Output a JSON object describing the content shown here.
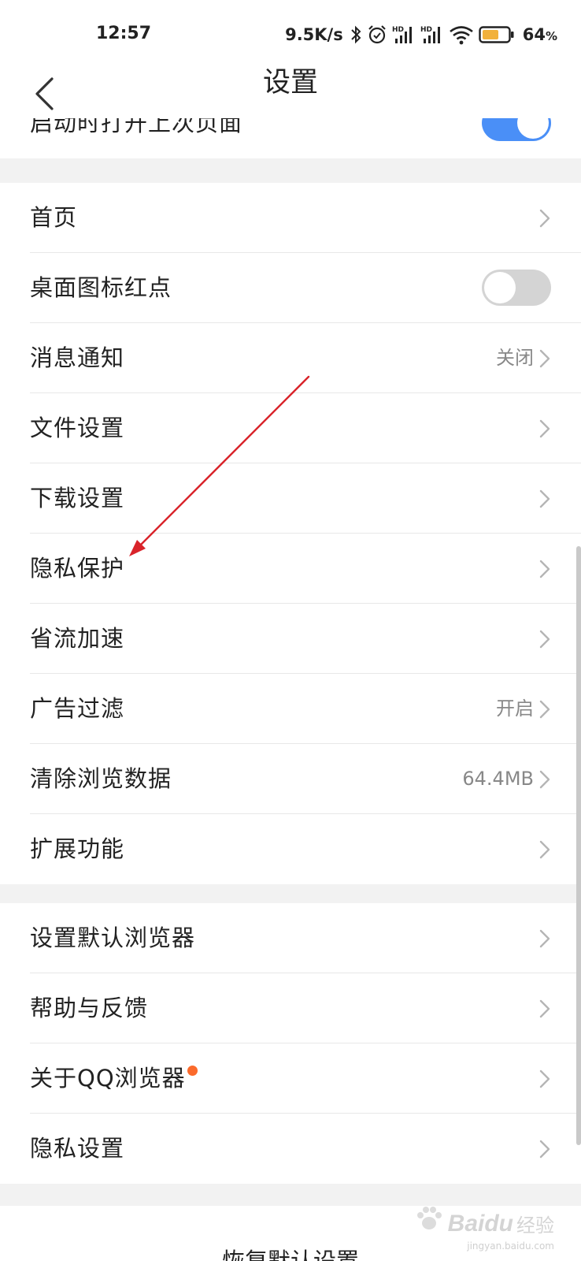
{
  "status_bar": {
    "time": "12:57",
    "net_speed": "9.5K/s",
    "battery_percent": "64",
    "battery_unit": "%",
    "battery_level": 0.64,
    "battery_color": "#f2b13a",
    "icons": [
      "bluetooth-icon",
      "alarm-icon",
      "hd-signal-icon",
      "hd-signal-icon",
      "wifi-icon",
      "battery-icon"
    ]
  },
  "header": {
    "title": "设置",
    "back_icon": "back-arrow-icon"
  },
  "top_partial_row": {
    "label": "启动时打开上次页面",
    "toggle_on": true
  },
  "group1": [
    {
      "label": "首页",
      "value": "",
      "control": "chevron"
    },
    {
      "label": "桌面图标红点",
      "value": "",
      "control": "toggle-off"
    },
    {
      "label": "消息通知",
      "value": "关闭",
      "control": "chevron"
    },
    {
      "label": "文件设置",
      "value": "",
      "control": "chevron"
    },
    {
      "label": "下载设置",
      "value": "",
      "control": "chevron"
    },
    {
      "label": "隐私保护",
      "value": "",
      "control": "chevron"
    },
    {
      "label": "省流加速",
      "value": "",
      "control": "chevron"
    },
    {
      "label": "广告过滤",
      "value": "开启",
      "control": "chevron"
    },
    {
      "label": "清除浏览数据",
      "value": "64.4MB",
      "control": "chevron"
    },
    {
      "label": "扩展功能",
      "value": "",
      "control": "chevron"
    }
  ],
  "group2": [
    {
      "label": "设置默认浏览器",
      "value": "",
      "control": "chevron"
    },
    {
      "label": "帮助与反馈",
      "value": "",
      "control": "chevron"
    },
    {
      "label": "关于QQ浏览器",
      "value": "",
      "control": "chevron",
      "badge": "red-dot"
    },
    {
      "label": "隐私设置",
      "value": "",
      "control": "chevron"
    }
  ],
  "restore": {
    "label": "恢复默认设置"
  },
  "colors": {
    "accent": "#4a8ff7",
    "badge": "#fb6a2b",
    "annotation": "#d9232a"
  },
  "watermark": {
    "brand": "Bai",
    "brand2": "du",
    "cn": "经验",
    "url": "jingyan.baidu.com"
  }
}
